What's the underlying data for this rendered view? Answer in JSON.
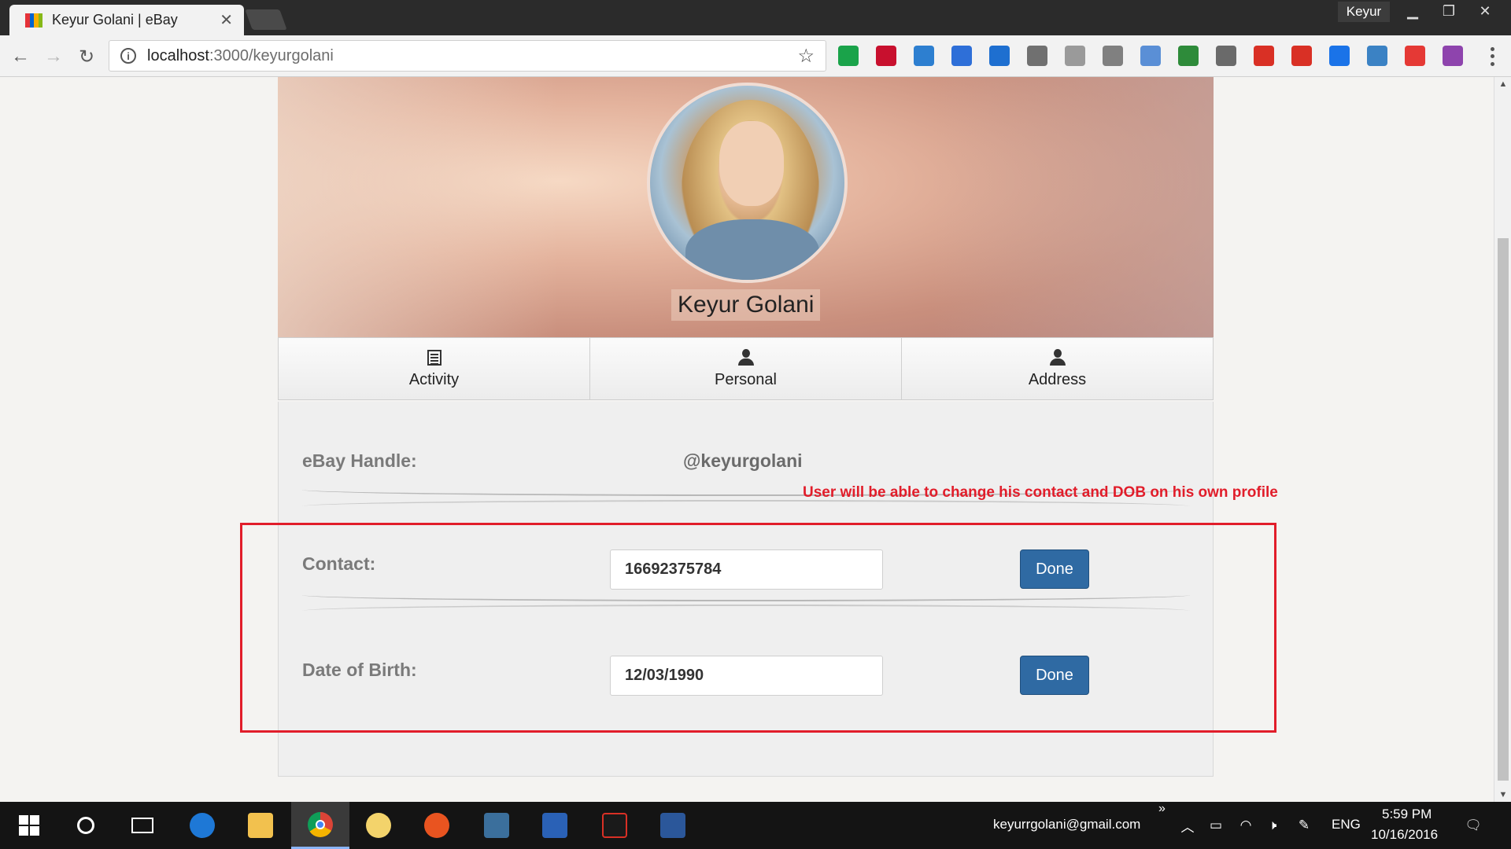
{
  "browser": {
    "tab_title": "Keyur Golani | eBay",
    "profile_name": "Keyur",
    "url_host": "localhost",
    "url_path": ":3000/keyurgolani",
    "extensions": [
      {
        "name": "ext-badge-icon",
        "color": "#1aa34a"
      },
      {
        "name": "acrobat-icon",
        "color": "#c8102e"
      },
      {
        "name": "stack-icon",
        "color": "#2d7fd0"
      },
      {
        "name": "cube-icon",
        "color": "#2e6fd8"
      },
      {
        "name": "megaphone-icon",
        "color": "#1e6fd0"
      },
      {
        "name": "pen-icon",
        "color": "#707070"
      },
      {
        "name": "angular-shield-icon",
        "color": "#9a9a9a"
      },
      {
        "name": "a-icon",
        "color": "#808080"
      },
      {
        "name": "window-icon",
        "color": "#5a8fd6"
      },
      {
        "name": "bw-icon",
        "color": "#2e8b3a"
      },
      {
        "name": "shield-icon",
        "color": "#6a6a6a"
      },
      {
        "name": "red-book-icon",
        "color": "#d93025"
      },
      {
        "name": "adblock-icon",
        "color": "#d93025"
      },
      {
        "name": "blue-window-icon",
        "color": "#1a73e8"
      },
      {
        "name": "toggle-icon",
        "color": "#3b82c4"
      },
      {
        "name": "red-puzzle-icon",
        "color": "#e53935"
      },
      {
        "name": "color-wheel-icon",
        "color": "#8e44ad"
      }
    ]
  },
  "profile": {
    "name": "Keyur Golani",
    "tabs": [
      {
        "label": "Activity",
        "icon": "list-icon"
      },
      {
        "label": "Personal",
        "icon": "user-icon"
      },
      {
        "label": "Address",
        "icon": "user-icon"
      }
    ]
  },
  "fields": {
    "handle_label": "eBay Handle:",
    "handle_value": "@keyurgolani",
    "contact_label": "Contact:",
    "contact_value": "16692375784",
    "dob_label": "Date of Birth:",
    "dob_value": "12/03/1990",
    "done_label": "Done"
  },
  "annotation": {
    "text": "User will be able to change his contact and DOB on his own profile",
    "color": "#e11d2a"
  },
  "taskbar": {
    "email": "keyurrgolani@gmail.com",
    "language": "ENG",
    "time": "5:59 PM",
    "date": "10/16/2016",
    "chevron": "»"
  }
}
